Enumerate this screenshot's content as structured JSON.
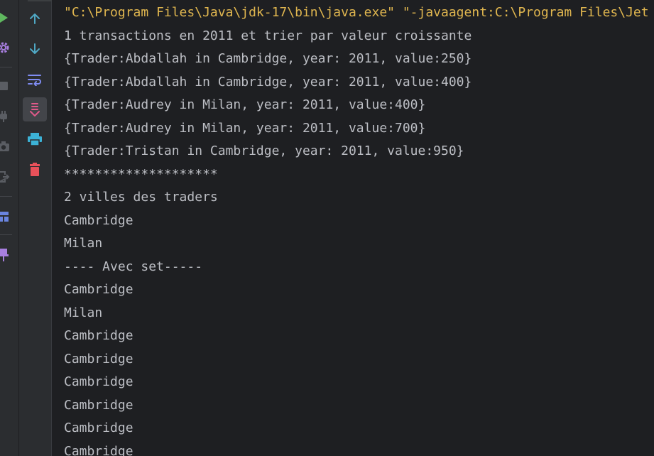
{
  "colors": {
    "console_bg": "#1e1f22",
    "panel_bg": "#2b2d30",
    "output_text": "#bcbec4",
    "command_text": "#e0b64f",
    "up_arrow": "#4fa8c4",
    "down_arrow": "#4fa8c4",
    "wrap_icon": "#7f8cf2",
    "scroll_end_icon": "#e05a8a",
    "print_icon": "#3cb2d6",
    "trash_icon": "#e8515a",
    "run_icon": "#5fb85f",
    "settings_icon": "#a87fe0",
    "layout_icon": "#6a85e0",
    "pin_icon": "#a87fe0"
  },
  "left_strip": {
    "icons": [
      "run-icon",
      "settings-icon",
      "stop-icon",
      "plug-icon",
      "camera-icon",
      "exit-icon",
      "layout-icon",
      "pin-icon"
    ]
  },
  "toolbar": {
    "buttons": [
      "up-arrow-icon",
      "down-arrow-icon",
      "soft-wrap-icon",
      "scroll-to-end-icon",
      "print-icon",
      "clear-all-icon"
    ]
  },
  "console": {
    "lines": [
      "\"C:\\Program Files\\Java\\jdk-17\\bin\\java.exe\" \"-javaagent:C:\\Program Files\\Jet",
      "1 transactions en 2011 et trier par valeur croissante",
      "{Trader:Abdallah in Cambridge, year: 2011, value:250}",
      "{Trader:Abdallah in Cambridge, year: 2011, value:400}",
      "{Trader:Audrey in Milan, year: 2011, value:400}",
      "{Trader:Audrey in Milan, year: 2011, value:700}",
      "{Trader:Tristan in Cambridge, year: 2011, value:950}",
      "********************",
      "2 villes des traders",
      "Cambridge",
      "Milan",
      "---- Avec set-----",
      "Cambridge",
      "Milan",
      "Cambridge",
      "Cambridge",
      "Cambridge",
      "Cambridge",
      "Cambridge",
      "Cambridge"
    ]
  }
}
